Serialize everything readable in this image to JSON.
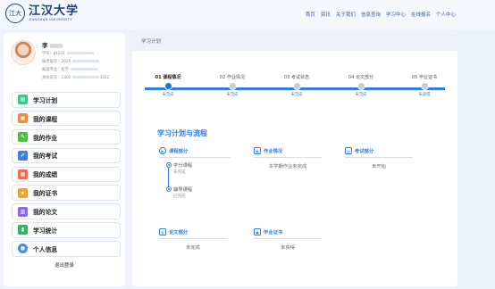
{
  "header": {
    "logo_seal": "江大",
    "logo_cn": "江汉大学",
    "logo_en": "JIANGHAN UNIVERSITY",
    "nav": [
      "首页",
      "资讯",
      "关于我们",
      "信息查询",
      "学习中心",
      "在线报名",
      "个人中心"
    ]
  },
  "profile": {
    "name": "李",
    "student_no_label": "学号：",
    "student_no": "JH332",
    "level_label": "报考层次：",
    "level": "2025",
    "major_label": "报读专业：",
    "major": "化学",
    "id_label": "身份证号：",
    "id_prefix": "1302",
    "id_suffix": "3322"
  },
  "menu": [
    {
      "label": "学习计划",
      "icon": "study-plan-icon",
      "color": "#3ec38b"
    },
    {
      "label": "我的课程",
      "icon": "course-icon",
      "color": "#f08a3c"
    },
    {
      "label": "我的作业",
      "icon": "homework-icon",
      "color": "#57b84a"
    },
    {
      "label": "我的考试",
      "icon": "exam-icon",
      "color": "#3f7fe0"
    },
    {
      "label": "我的成绩",
      "icon": "score-icon",
      "color": "#f06b56"
    },
    {
      "label": "我的证书",
      "icon": "certificate-icon",
      "color": "#f0a030"
    },
    {
      "label": "我的论文",
      "icon": "thesis-icon",
      "color": "#8a6ae0"
    },
    {
      "label": "学习统计",
      "icon": "statistics-icon",
      "color": "#3aaf68"
    },
    {
      "label": "个人信息",
      "icon": "profile-icon",
      "color": "#3f90e0"
    }
  ],
  "logout_label": "退出登录",
  "main": {
    "breadcrumb": "学习计划",
    "steps": [
      {
        "label": "01 课程情况",
        "status": "未完成",
        "active": true
      },
      {
        "label": "02 作业情况",
        "status": "未完成",
        "active": false
      },
      {
        "label": "03 考试状态",
        "status": "未完成",
        "active": false
      },
      {
        "label": "04 论文部分",
        "status": "未完成",
        "active": false
      },
      {
        "label": "05 毕业证书",
        "status": "未获得",
        "active": false
      }
    ],
    "section_title": "学习计划与流程",
    "cards": {
      "course": {
        "title": "课程部分",
        "items": [
          {
            "title": "学分课程",
            "status": "未完成"
          },
          {
            "title": "辅导课程",
            "status": "已完成"
          }
        ]
      },
      "homework": {
        "title": "作业情况",
        "text": "本学期作业未完成"
      },
      "exam": {
        "title": "考试部分",
        "text": "未开始"
      },
      "thesis": {
        "title": "论文部分",
        "text": "未完成"
      },
      "certificate": {
        "title": "毕业证书",
        "text": "未获得"
      }
    }
  },
  "colors": {
    "accent": "#2e7ee3",
    "brand": "#1d3f8a",
    "background": "#eef3fb"
  }
}
